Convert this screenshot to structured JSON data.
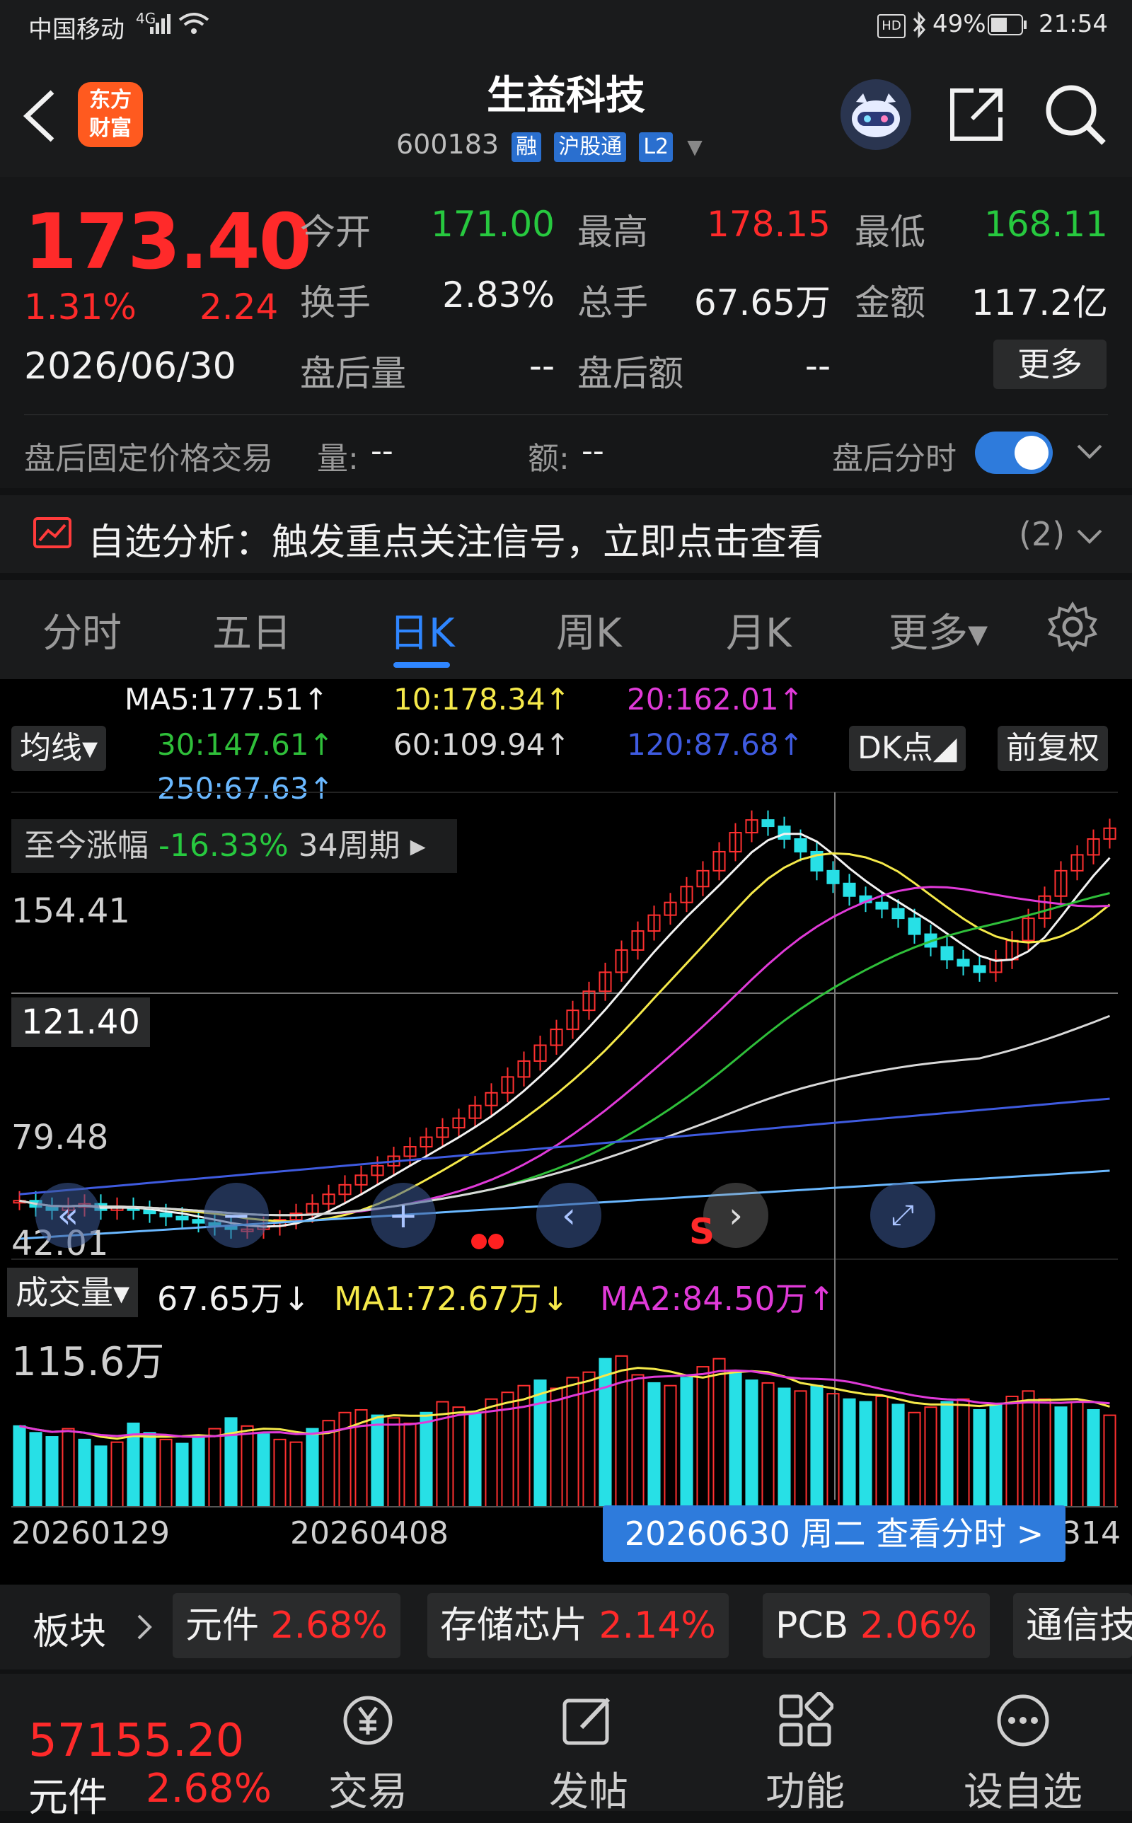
{
  "status_bar": {
    "carrier": "中国移动",
    "network": "4G",
    "battery": "49%",
    "time": "21:54",
    "hd": "HD"
  },
  "header": {
    "title": "生益科技",
    "code": "600183",
    "tags": [
      "融",
      "沪股通",
      "L2"
    ],
    "logo_line1": "东方",
    "logo_line2": "财富"
  },
  "quote": {
    "price": "173.40",
    "change_pct": "1.31%",
    "change": "2.24",
    "date": "2026/06/30",
    "rows": [
      [
        {
          "label": "今开",
          "value": "171.00",
          "color": "green"
        },
        {
          "label": "最高",
          "value": "178.15",
          "color": "red"
        },
        {
          "label": "最低",
          "value": "168.11",
          "color": "green"
        }
      ],
      [
        {
          "label": "换手",
          "value": "2.83%",
          "color": "white"
        },
        {
          "label": "总手",
          "value": "67.65万",
          "color": "white"
        },
        {
          "label": "金额",
          "value": "117.2亿",
          "color": "white"
        }
      ],
      [
        {
          "label": "盘后量",
          "value": "--",
          "color": "white"
        },
        {
          "label": "盘后额",
          "value": "--",
          "color": "white"
        }
      ]
    ],
    "more": "更多",
    "after_hours_label": "盘后固定价格交易",
    "vol_label": "量:",
    "vol_value": "--",
    "amt_label": "额:",
    "amt_value": "--",
    "after_hours_time": "盘后分时"
  },
  "analysis": {
    "text": "自选分析：触发重点关注信号，立即点击查看",
    "count": "(2)"
  },
  "tabs": [
    {
      "label": "分时"
    },
    {
      "label": "五日"
    },
    {
      "label": "日K"
    },
    {
      "label": "周K"
    },
    {
      "label": "月K"
    },
    {
      "label": "更多▾"
    }
  ],
  "active_tab": "日K",
  "ma_legend": [
    {
      "text": "MA5:177.51↑",
      "color": "#f2f2f2"
    },
    {
      "text": "10:178.34↑",
      "color": "#f5e94a"
    },
    {
      "text": "20:162.01↑",
      "color": "#e03ad8"
    },
    {
      "text": "30:147.61↑",
      "color": "#2fbf3a"
    },
    {
      "text": "60:109.94↑",
      "color": "#d8d8d8"
    },
    {
      "text": "120:87.68↑",
      "color": "#3f5be0"
    },
    {
      "text": "250:67.63↑",
      "color": "#6ab8ff"
    }
  ],
  "chart_controls": {
    "ma_select": "均线▾",
    "dk": "DK点◢",
    "adjust": "前复权"
  },
  "range_info": {
    "label": "至今涨幅",
    "pct": "-16.33%",
    "period": "34周期 ▸"
  },
  "chart_data": {
    "type": "candlestick",
    "price_axis_labels": [
      "154.41",
      "121.40",
      "79.48",
      "42.01"
    ],
    "ylim": [
      42.01,
      180.26
    ],
    "crosshair_price": "121.40",
    "date_labels": [
      "20260129",
      "20260408"
    ],
    "selected_date": "20260630 周二 查看分时 >",
    "right_date_stub": "314",
    "signal": "S",
    "closes": [
      56,
      54,
      53,
      54,
      55,
      53,
      54,
      53,
      52,
      51,
      50,
      49,
      48,
      47,
      47,
      48,
      50,
      52,
      55,
      58,
      61,
      64,
      67,
      70,
      73,
      76,
      79,
      82,
      86,
      90,
      95,
      100,
      105,
      110,
      116,
      122,
      128,
      135,
      141,
      146,
      150,
      155,
      160,
      166,
      172,
      176,
      174,
      170,
      166,
      160,
      156,
      152,
      150,
      148,
      145,
      140,
      136,
      132,
      130,
      128,
      132,
      138,
      145,
      152,
      160,
      165,
      170,
      173.4
    ],
    "volume": {
      "label": "成交量▾",
      "value": "67.65万↓",
      "ma1": "MA1:72.67万↓",
      "ma2": "MA2:84.50万↑",
      "max_label": "115.6万",
      "values_wan": [
        60,
        55,
        52,
        58,
        50,
        45,
        48,
        62,
        55,
        50,
        47,
        52,
        58,
        66,
        60,
        54,
        50,
        48,
        58,
        64,
        70,
        72,
        68,
        66,
        62,
        70,
        78,
        74,
        70,
        80,
        85,
        90,
        94,
        88,
        96,
        100,
        110,
        112,
        98,
        92,
        90,
        96,
        104,
        110,
        100,
        94,
        92,
        88,
        86,
        90,
        84,
        80,
        78,
        82,
        76,
        70,
        74,
        78,
        80,
        72,
        76,
        82,
        86,
        80,
        74,
        78,
        72,
        68
      ],
      "up_flags": [
        0,
        0,
        0,
        1,
        0,
        0,
        1,
        0,
        0,
        1,
        0,
        0,
        1,
        0,
        1,
        0,
        1,
        1,
        0,
        1,
        1,
        1,
        0,
        1,
        1,
        0,
        1,
        1,
        0,
        1,
        1,
        1,
        0,
        1,
        1,
        1,
        0,
        1,
        1,
        0,
        1,
        0,
        1,
        1,
        0,
        0,
        1,
        0,
        1,
        0,
        1,
        0,
        0,
        1,
        0,
        1,
        1,
        0,
        1,
        0,
        0,
        1,
        1,
        1,
        0,
        1,
        0,
        1
      ]
    }
  },
  "sectors": {
    "label": "板块",
    "items": [
      {
        "name": "元件",
        "pct": "2.68%"
      },
      {
        "name": "存储芯片",
        "pct": "2.14%"
      },
      {
        "name": "PCB",
        "pct": "2.06%"
      },
      {
        "name": "通信技",
        "pct": ""
      }
    ]
  },
  "bottom": {
    "index_value": "57155.20",
    "index_name": "元件",
    "index_pct": "2.68%",
    "nav": [
      {
        "label": "交易"
      },
      {
        "label": "发帖"
      },
      {
        "label": "功能"
      },
      {
        "label": "设自选"
      }
    ]
  }
}
